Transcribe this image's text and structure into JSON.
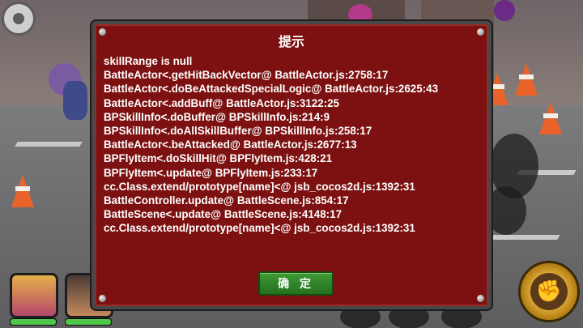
{
  "dialog": {
    "title": "提示",
    "message_lines": [
      "skillRange is null",
      "BattleActor<.getHitBackVector@ BattleActor.js:2758:17",
      "BattleActor<.doBeAttackedSpecialLogic@ BattleActor.js:2625:43",
      "BattleActor<.addBuff@ BattleActor.js:3122:25",
      "BPSkillInfo<.doBuffer@ BPSkillInfo.js:214:9",
      "BPSkillInfo<.doAllSkillBuffer@ BPSkillInfo.js:258:17",
      "BattleActor<.beAttacked@ BattleActor.js:2677:13",
      "BPFlyItem<.doSkillHit@ BPFlyItem.js:428:21",
      "BPFlyItem<.update@ BPFlyItem.js:233:17",
      "cc.Class.extend/prototype[name]<@ jsb_cocos2d.js:1392:31",
      "BattleController.update@ BattleScene.js:854:17",
      "BattleScene<.update@ BattleScene.js:4148:17",
      "cc.Class.extend/prototype[name]<@ jsb_cocos2d.js:1392:31"
    ],
    "ok_label": "确 定",
    "colors": {
      "panel": "#7d1111",
      "border": "#484848",
      "button": "#2f8a29",
      "text": "#ffffff"
    }
  },
  "hud": {
    "settings_icon": "gear-icon",
    "hero_portraits": [
      {
        "icon": "hero-portrait-icon",
        "health_fraction": 1.0
      },
      {
        "icon": "hero-portrait-icon",
        "health_fraction": 1.0
      }
    ],
    "skill_icon": "fist-icon"
  }
}
